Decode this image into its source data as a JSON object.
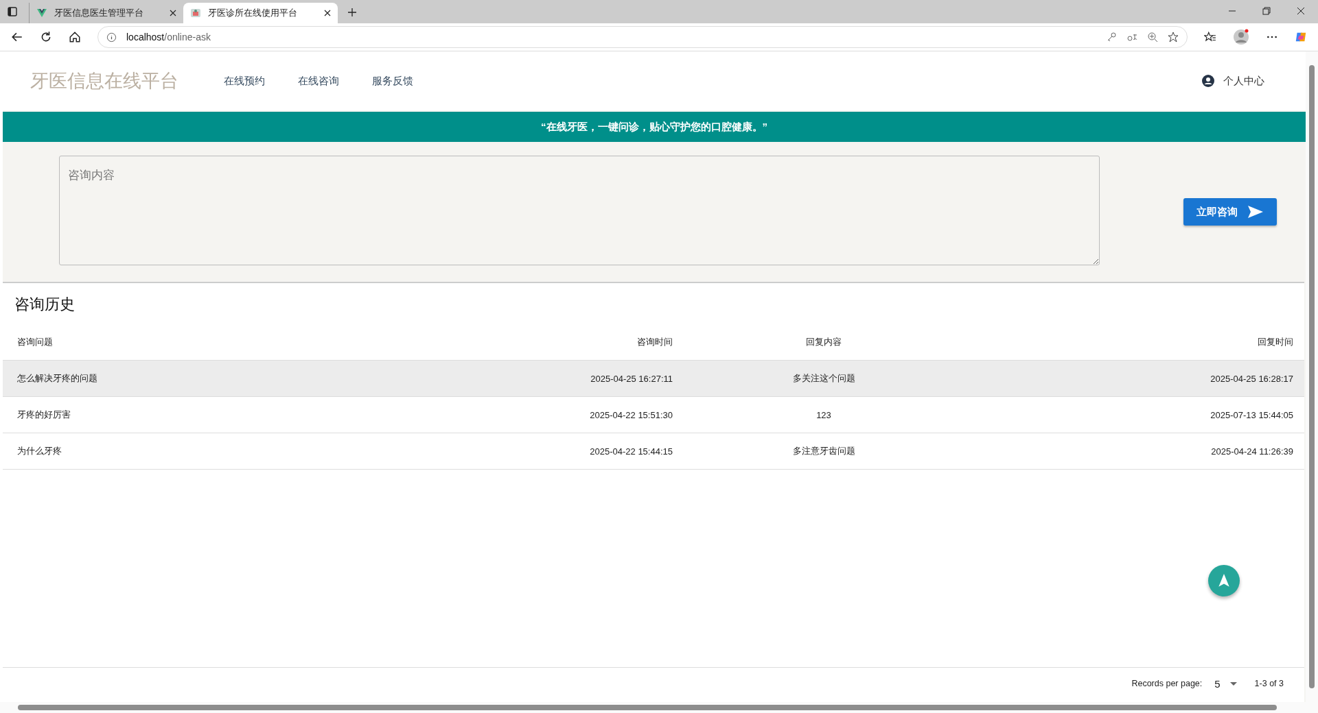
{
  "browser": {
    "tabs": [
      {
        "title": "牙医信息医生管理平台",
        "selected": false
      },
      {
        "title": "牙医诊所在线使用平台",
        "selected": true
      }
    ],
    "url_host": "localhost",
    "url_path": "/online-ask"
  },
  "header": {
    "logo": "牙医信息在线平台",
    "nav": [
      "在线预约",
      "在线咨询",
      "服务反馈"
    ],
    "user": "个人中心"
  },
  "banner": "“在线牙医，一键问诊，贴心守护您的口腔健康。”",
  "consult": {
    "placeholder": "咨询内容",
    "button": "立即咨询"
  },
  "history": {
    "title": "咨询历史",
    "columns": [
      "咨询问题",
      "咨询时间",
      "回复内容",
      "回复时间"
    ],
    "rows": [
      {
        "cells": [
          "怎么解决牙疼的问题",
          "2025-04-25 16:27:11",
          "多关注这个问题",
          "2025-04-25 16:28:17"
        ],
        "selected": true
      },
      {
        "cells": [
          "牙疼的好厉害",
          "2025-04-22 15:51:30",
          "123",
          "2025-07-13 15:44:05"
        ],
        "selected": false
      },
      {
        "cells": [
          "为什么牙疼",
          "2025-04-22 15:44:15",
          "多注意牙齿问题",
          "2025-04-24 11:26:39"
        ],
        "selected": false
      }
    ],
    "footer": {
      "per_page_label": "Records per page:",
      "per_page": "5",
      "range": "1-3 of 3"
    }
  }
}
